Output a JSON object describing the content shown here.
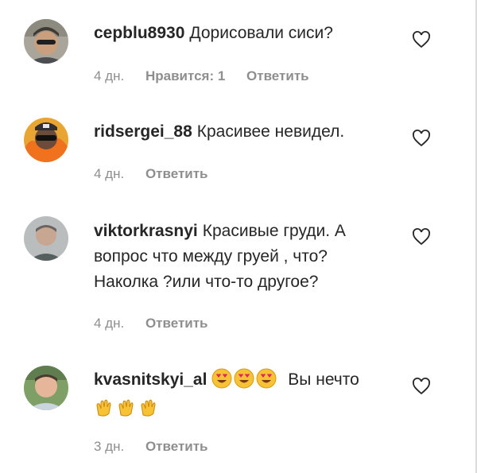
{
  "comments": [
    {
      "username": "cepblu8930",
      "text": "Дорисовали сиси?",
      "time": "4 дн.",
      "likes": "Нравится: 1",
      "reply": "Ответить",
      "avatar_color": "#6d6a5e"
    },
    {
      "username": "ridsergei_88",
      "text": "Красивее невидел.",
      "time": "4 дн.",
      "reply": "Ответить",
      "avatar_color": "#c58b2c"
    },
    {
      "username": "viktorkrasnyi",
      "text": "Красивые груди. А вопрос что между груей , что? Наколка ?или что-то другое?",
      "time": "4 дн.",
      "reply": "Ответить",
      "avatar_color": "#9aa0a2"
    },
    {
      "username": "kvasnitskyi_al",
      "text": "Вы нечто",
      "time": "3 дн.",
      "reply": "Ответить",
      "avatar_color": "#6f8e5e",
      "emoji_before": [
        "heart-eyes",
        "heart-eyes",
        "heart-eyes"
      ],
      "emoji_after": [
        "clapping-hands",
        "clapping-hands",
        "clapping-hands"
      ]
    }
  ],
  "colors": {
    "text": "#262626",
    "meta": "#8e8e8e",
    "heart_outline": "#262626"
  }
}
